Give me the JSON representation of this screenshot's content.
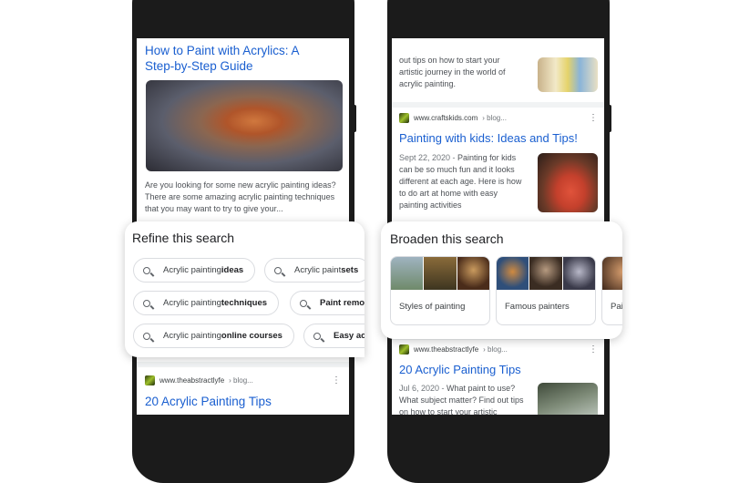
{
  "left_phone": {
    "top_result": {
      "title": "How to Paint with Acrylics: A Step-by-Step Guide",
      "snippet": "Are you looking for some new acrylic painting ideas? There are some amazing acrylic painting techniques that you may want to try to give your..."
    },
    "refine_card": {
      "heading": "Refine this search",
      "chips": [
        {
          "prefix": "Acrylic painting ",
          "bold": "ideas"
        },
        {
          "prefix": "Acrylic paint ",
          "bold": "sets"
        },
        {
          "prefix": "Acrylic painting ",
          "bold": "techniques"
        },
        {
          "prefix": "",
          "bold": "Paint remo"
        },
        {
          "prefix": "Acrylic painting ",
          "bold": "online courses"
        },
        {
          "prefix": "",
          "bold": "Easy ac"
        }
      ]
    },
    "bottom_result": {
      "site": "www.theabstractlyfe",
      "path": "› blog...",
      "title": "20 Acrylic Painting Tips"
    }
  },
  "right_phone": {
    "top_snippet": "out tips on how to start your artistic journey in the world of acrylic painting.",
    "middle_result": {
      "site": "www.craftskids.com",
      "path": "› blog...",
      "title": "Painting with kids: Ideas and Tips!",
      "date": "Sept 22, 2020 - ",
      "snippet": "Painting for kids can be so much fun and it looks different at each age. Here is how to do art at home with easy painting activities"
    },
    "broaden_card": {
      "heading": "Broaden this search",
      "items": [
        {
          "label": "Styles of painting"
        },
        {
          "label": "Famous painters"
        },
        {
          "label": "Pai"
        }
      ]
    },
    "bottom_result": {
      "site": "www.theabstractlyfe",
      "path": "› blog...",
      "title": "20 Acrylic Painting Tips",
      "date": "Jul 6, 2020 - ",
      "snippet": "What paint to use? What subject matter? Find out tips on how to start your artistic"
    }
  },
  "colors": {
    "link": "#1a5fd0",
    "phone": "#1b1b1b"
  }
}
